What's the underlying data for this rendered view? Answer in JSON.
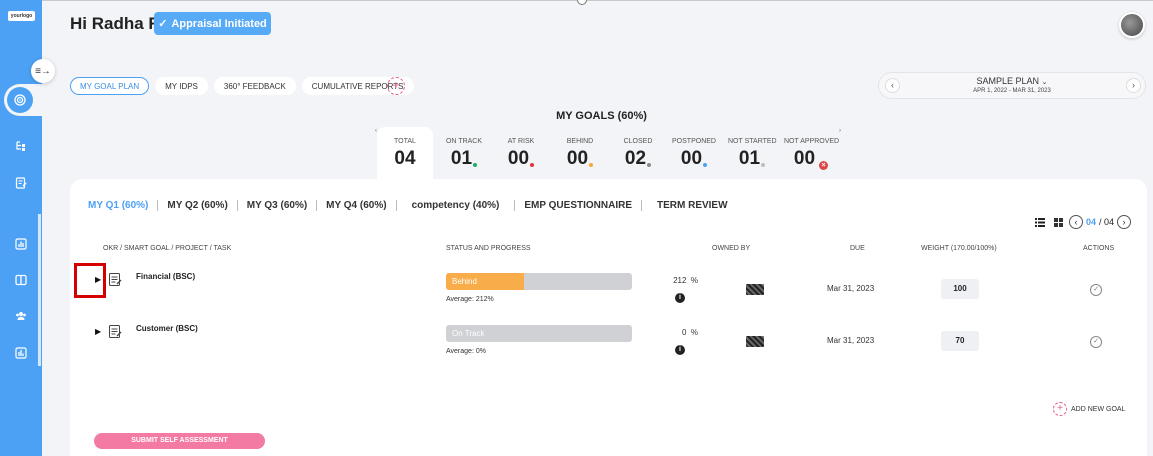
{
  "app": {
    "logo_text": "yourlogo"
  },
  "header": {
    "greeting": "Hi Radha R",
    "status_button": "Appraisal Initiated"
  },
  "tabs": [
    "MY GOAL PLAN",
    "MY IDPS",
    "360° FEEDBACK",
    "CUMULATIVE REPORTS"
  ],
  "plan": {
    "name": "SAMPLE PLAN",
    "dates": "APR 1, 2022 - MAR 31, 2023"
  },
  "goals_summary": {
    "title": "MY GOALS (60%)",
    "stats": [
      {
        "label": "TOTAL",
        "value": "04",
        "dot_color": ""
      },
      {
        "label": "ON TRACK",
        "value": "01",
        "dot_color": "#1fae6b"
      },
      {
        "label": "AT RISK",
        "value": "00",
        "dot_color": "#e0343a"
      },
      {
        "label": "BEHIND",
        "value": "00",
        "dot_color": "#f6a83a"
      },
      {
        "label": "CLOSED",
        "value": "02",
        "dot_color": "#8a8a8a"
      },
      {
        "label": "POSTPONED",
        "value": "00",
        "dot_color": "#4ca1f5"
      },
      {
        "label": "NOT STARTED",
        "value": "01",
        "dot_color": "#bdbdbd"
      },
      {
        "label": "NOT APPROVED",
        "value": "00",
        "dot_color": ""
      }
    ]
  },
  "quarter_tabs": [
    "MY Q1 (60%)",
    "MY Q2 (60%)",
    "MY Q3 (60%)",
    "MY Q4 (60%)",
    "competency (40%)",
    "EMP QUESTIONNAIRE",
    "TERM REVIEW"
  ],
  "pager": {
    "current": "04",
    "total": "/ 04"
  },
  "columns": {
    "goal": "OKR / SMART GOAL / PROJECT / TASK",
    "status": "STATUS AND PROGRESS",
    "owned_by": "OWNED BY",
    "due": "DUE",
    "weight": "WEIGHT (170.00/100%)",
    "actions": "ACTIONS"
  },
  "goals": [
    {
      "name": "Financial (BSC)",
      "status": "Behind",
      "progress_fraction": 0.42,
      "average": "Average: 212%",
      "percent": "212",
      "unit": "%",
      "due": "Mar 31, 2023",
      "weight": "100"
    },
    {
      "name": "Customer (BSC)",
      "status": "On Track",
      "progress_fraction": 0,
      "average": "Average: 0%",
      "percent": "0",
      "unit": "%",
      "due": "Mar 31, 2023",
      "weight": "70"
    }
  ],
  "add_goal": "ADD NEW GOAL",
  "submit": "SUBMIT SELF ASSESSMENT"
}
